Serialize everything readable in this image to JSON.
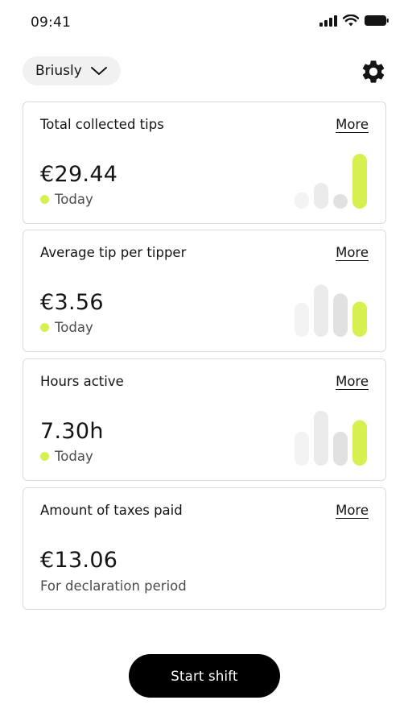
{
  "status_bar": {
    "time": "09:41",
    "icons": [
      "cellular-signal-icon",
      "wifi-icon",
      "battery-icon"
    ]
  },
  "header": {
    "workspace": "Briusly",
    "dropdown_icon": "chevron-down-icon",
    "settings_icon": "gear-icon"
  },
  "colors": {
    "accent": "#d7f04f",
    "bar_past": [
      "#f3f3f3",
      "#ebebeb",
      "#e1e1e1"
    ],
    "button": "#000000"
  },
  "cards": [
    {
      "title": "Total collected tips",
      "more": "More",
      "value": "€29.44",
      "subtitle": "Today",
      "show_dot": true,
      "chart_data": {
        "type": "bar",
        "values": [
          0.3,
          0.47,
          0.26,
          1.0
        ],
        "highlight_last": true
      }
    },
    {
      "title": "Average tip per tipper",
      "more": "More",
      "value": "€3.56",
      "subtitle": "Today",
      "show_dot": true,
      "chart_data": {
        "type": "bar",
        "values": [
          0.62,
          0.95,
          0.79,
          0.64
        ],
        "highlight_last": true
      }
    },
    {
      "title": "Hours active",
      "more": "More",
      "value": "7.30h",
      "subtitle": "Today",
      "show_dot": true,
      "chart_data": {
        "type": "bar",
        "values": [
          0.62,
          1.0,
          0.62,
          0.83
        ],
        "highlight_last": true
      }
    },
    {
      "title": "Amount of taxes paid",
      "more": "More",
      "value": "€13.06",
      "subtitle": "For declaration period",
      "show_dot": false
    }
  ],
  "start_button": {
    "label": "Start shift"
  }
}
